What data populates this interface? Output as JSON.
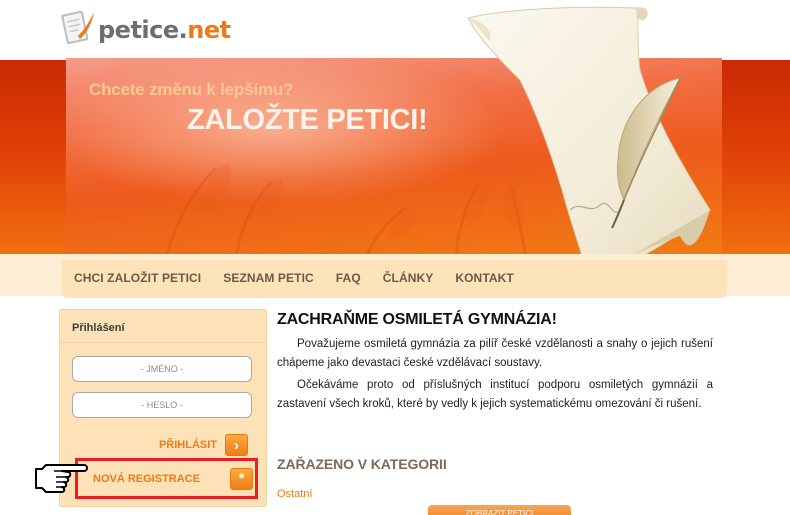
{
  "logo": {
    "part1": "petice.",
    "part2": "net"
  },
  "hero": {
    "tagline": "Chcete změnu k lepšímu?",
    "title": "ZALOŽTE PETICI!"
  },
  "nav": {
    "items": [
      "CHCI ZALOŽIT PETICI",
      "SEZNAM PETIC",
      "FAQ",
      "ČLÁNKY",
      "KONTAKT"
    ]
  },
  "login": {
    "title": "Přihlášení",
    "name_placeholder": "- JMÉNO -",
    "password_placeholder": "- HESLO -",
    "login_label": "PŘIHLÁSIT",
    "login_icon": "›",
    "register_label": "NOVÁ REGISTRACE",
    "register_icon": "*"
  },
  "petition": {
    "title": "ZACHRAŇME OSMILETÁ GYMNÁZIA!",
    "paragraph1": "Považujeme osmiletá gymnázia za pilíř české vzdělanosti a snahy o jejich rušení chápeme jako devastaci české vzdělávací soustavy.",
    "paragraph2": "Očekáváme proto od příslušných institucí podporu osmiletých gymnázií a zastavení všech kroků, které by vedly k jejich systematickému omezování či rušení.",
    "category_heading": "ZAŘAZENO V KATEGORII",
    "category": "Ostatní",
    "show_button": "ZOBRAZIT PETICI"
  },
  "colors": {
    "accent": "#ef7a16",
    "highlight": "#ee1c24",
    "nav_bg": "#fce3b9",
    "panel_bg": "#fde2b8"
  },
  "icons": [
    "logo-icon",
    "quill-paper-illustration",
    "arrow-right-icon",
    "asterisk-icon",
    "pointing-hand-cursor-icon"
  ]
}
